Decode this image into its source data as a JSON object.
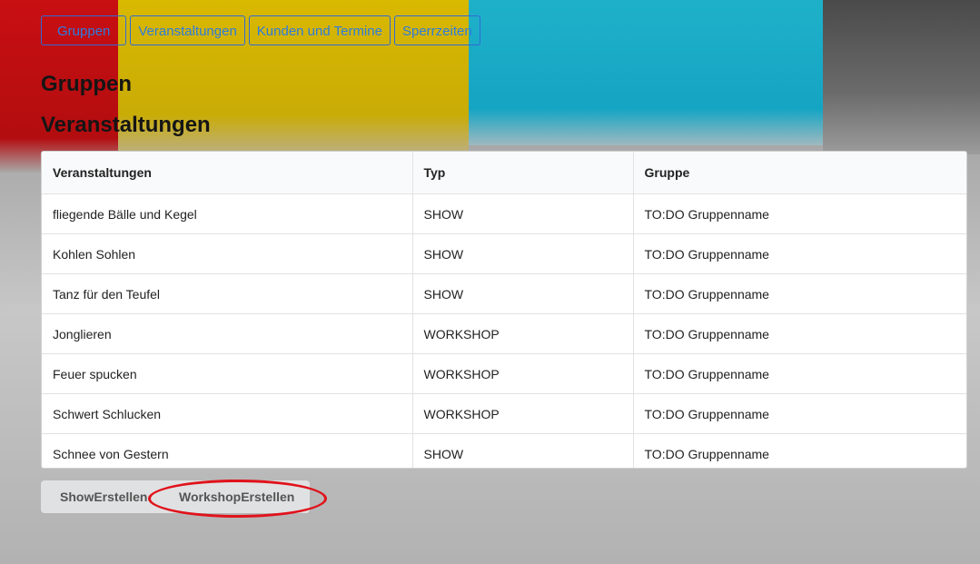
{
  "nav": {
    "tabs": [
      {
        "label": "Gruppen"
      },
      {
        "label": "Veranstaltungen"
      },
      {
        "label": "Kunden und Termine"
      },
      {
        "label": "Sperrzeiten"
      }
    ]
  },
  "headings": {
    "gruppen": "Gruppen",
    "veranstaltungen": "Veranstaltungen"
  },
  "table": {
    "columns": [
      "Veranstaltungen",
      "Typ",
      "Gruppe"
    ],
    "rows": [
      {
        "name": "fliegende Bälle und Kegel",
        "typ": "SHOW",
        "gruppe": "TO:DO Gruppenname"
      },
      {
        "name": "Kohlen Sohlen",
        "typ": "SHOW",
        "gruppe": "TO:DO Gruppenname"
      },
      {
        "name": "Tanz für den Teufel",
        "typ": "SHOW",
        "gruppe": "TO:DO Gruppenname"
      },
      {
        "name": "Jonglieren",
        "typ": "WORKSHOP",
        "gruppe": "TO:DO Gruppenname"
      },
      {
        "name": "Feuer spucken",
        "typ": "WORKSHOP",
        "gruppe": "TO:DO Gruppenname"
      },
      {
        "name": "Schwert Schlucken",
        "typ": "WORKSHOP",
        "gruppe": "TO:DO Gruppenname"
      },
      {
        "name": "Schnee von Gestern",
        "typ": "SHOW",
        "gruppe": "TO:DO Gruppenname"
      }
    ]
  },
  "buttons": {
    "show_create": "ShowErstellen",
    "workshop_create": "WorkshopErstellen"
  },
  "colors": {
    "link": "#2d7be0",
    "highlight": "#e0121b"
  }
}
